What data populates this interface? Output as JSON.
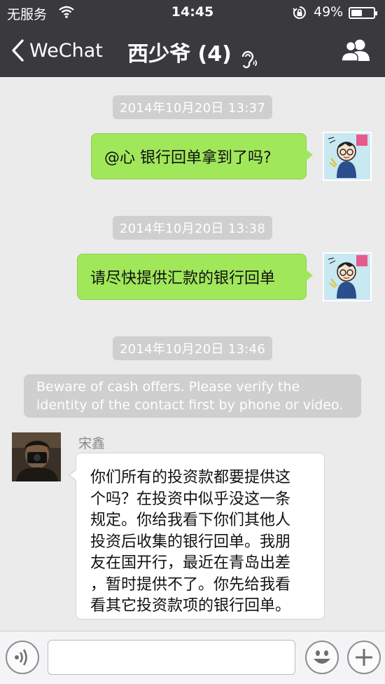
{
  "status_bar": {
    "carrier": "无服务",
    "time": "14:45",
    "battery_percent": "49%",
    "battery_level": 0.49,
    "icons": [
      "wifi-icon",
      "orientation-lock-icon",
      "battery-icon"
    ]
  },
  "nav": {
    "back_label": "WeChat",
    "title": "西少爷 (4)",
    "icons": [
      "chevron-left-icon",
      "earpiece-mode-icon",
      "group-members-icon"
    ]
  },
  "messages": [
    {
      "time": "2014年10月20日 13:37",
      "text": "@心 银行回单拿到了吗?"
    },
    {
      "time": "2014年10月20日 13:38",
      "text": "请尽快提供汇款的银行回单"
    },
    {
      "time": "2014年10月20日 13:46"
    }
  ],
  "notice": {
    "line1": "Beware of cash offers. Please verify the",
    "line2": "identity of the contact first by phone or video."
  },
  "incoming": {
    "sender": "宋鑫",
    "lines": [
      "你们所有的投资款都要提供这",
      "个吗？在投资中似乎没这一条",
      "规定。你给我看下你们其他人",
      "投资后收集的银行回单。我朋",
      "友在国开行，最近在青岛出差",
      "，暂时提供不了。你先给我看",
      "看其它投资款项的银行回单。"
    ]
  },
  "input_bar": {
    "placeholder": "",
    "icons": [
      "voice-icon",
      "emoji-icon",
      "plus-icon"
    ]
  },
  "colors": {
    "nav_bg": "#3a3a3e",
    "chat_bg": "#ebebeb",
    "bubble_out": "#a0e75a",
    "bubble_in": "#ffffff",
    "timestamp_bg": "#cfcfcf"
  }
}
